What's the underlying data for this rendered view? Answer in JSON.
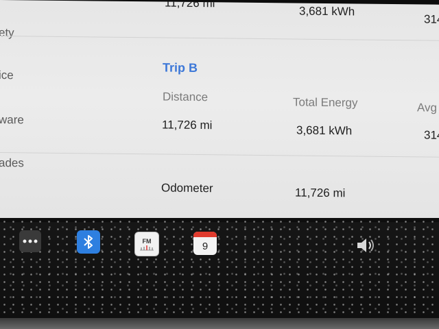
{
  "sidebar": {
    "items": [
      {
        "label": "ety"
      },
      {
        "label": "ice"
      },
      {
        "label": "ware"
      },
      {
        "label": "ades"
      }
    ]
  },
  "trip_a": {
    "distance": "11,726 mi",
    "energy": "3,681 kWh",
    "avg": "314"
  },
  "trip_b": {
    "title": "Trip B",
    "headers": {
      "distance": "Distance",
      "energy": "Total Energy",
      "avg": "Avg"
    },
    "distance": "11,726 mi",
    "energy": "3,681 kWh",
    "avg": "314"
  },
  "odometer": {
    "label": "Odometer",
    "value": "11,726 mi"
  },
  "dock": {
    "radio_label": "FM",
    "calendar_day": "9"
  },
  "colors": {
    "accent": "#3d78d8",
    "bluetooth": "#2e7fe0",
    "calendar_red": "#e03b2e"
  }
}
